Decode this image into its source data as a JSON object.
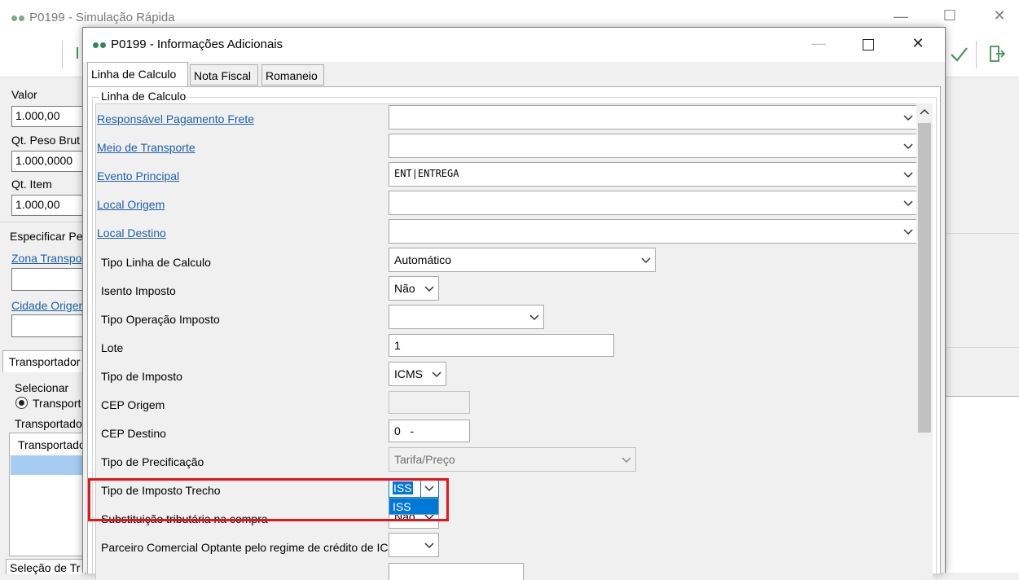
{
  "bg_window": {
    "title": "P0199 - Simulação Rápida",
    "left_labels": {
      "valor": "Valor",
      "valor_value": "1.000,00",
      "peso": "Qt. Peso Brut",
      "peso_value": "1.000,0000",
      "item": "Qt. Item",
      "item_value": "1.000,00",
      "especificar": "Especificar Pe",
      "zona": "Zona Transpo",
      "cidade": "Cidade Origen",
      "transportador_tab": "Transportador",
      "selecionar": "Selecionar",
      "transport_radio": "Transport",
      "transportado_group": "Transportado",
      "transportado_col": "Transportado",
      "selecao": "Seleção de Tr"
    }
  },
  "dialog": {
    "title": "P0199 - Informações Adicionais",
    "tabs": [
      "Linha de Calculo",
      "Nota Fiscal",
      "Romaneio"
    ],
    "group_title": "Linha de Calculo",
    "rows": [
      {
        "label": "Responsável Pagamento Frete",
        "value": ""
      },
      {
        "label": "Meio de Transporte",
        "value": ""
      },
      {
        "label": "Evento Principal",
        "value": "ENT|ENTREGA"
      },
      {
        "label": "Local Origem",
        "value": ""
      },
      {
        "label": "Local Destino",
        "value": ""
      },
      {
        "label": "Tipo Linha de Calculo",
        "value": "Automático"
      },
      {
        "label": "Isento Imposto",
        "value": "Não"
      },
      {
        "label": "Tipo Operação Imposto",
        "value": ""
      },
      {
        "label": "Lote",
        "value": "1"
      },
      {
        "label": "Tipo de Imposto",
        "value": "ICMS"
      },
      {
        "label": "CEP Origem",
        "value": ""
      },
      {
        "label": "CEP Destino",
        "value": "0   -"
      },
      {
        "label": "Tipo de Precificação",
        "value": "Tarifa/Preço"
      },
      {
        "label": "Tipo de Imposto Trecho",
        "value": "ISS"
      },
      {
        "label": "Substituição tributária na compra",
        "value": "Não"
      },
      {
        "label": "Parceiro Comercial Optante pelo regime de crédito de IC",
        "value": ""
      }
    ],
    "dropdown_option": "ISS"
  },
  "colors": {
    "link": "#1f5fa8",
    "highlight": "#e8141c",
    "selection": "#0078d7"
  }
}
